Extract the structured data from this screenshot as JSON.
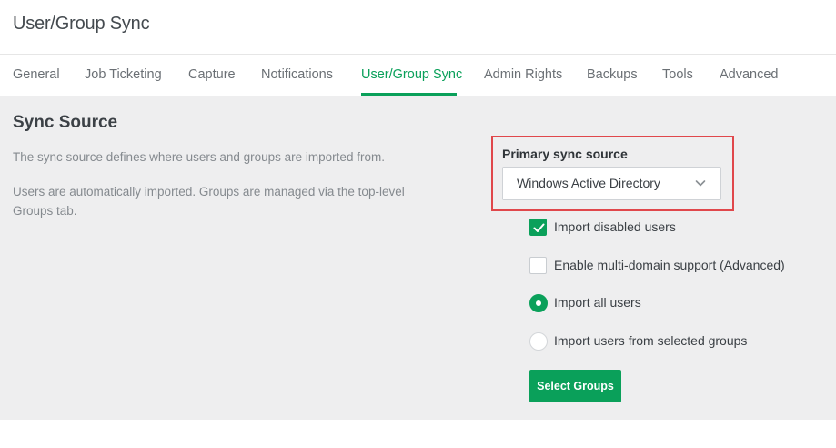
{
  "page": {
    "title": "User/Group Sync"
  },
  "tabs": [
    {
      "label": "General",
      "active": false
    },
    {
      "label": "Job Ticketing",
      "active": false
    },
    {
      "label": "Capture",
      "active": false
    },
    {
      "label": "Notifications",
      "active": false
    },
    {
      "label": "User/Group Sync",
      "active": true
    },
    {
      "label": "Admin Rights",
      "active": false
    },
    {
      "label": "Backups",
      "active": false
    },
    {
      "label": "Tools",
      "active": false
    },
    {
      "label": "Advanced",
      "active": false
    }
  ],
  "sync_source": {
    "title": "Sync Source",
    "description_1": "The sync source defines where users and groups are imported from.",
    "description_2": "Users are automatically imported. Groups are managed via the top-level Groups tab.",
    "primary_label": "Primary sync source",
    "primary_value": "Windows Active Directory",
    "options": {
      "import_disabled": {
        "label": "Import disabled users",
        "checked": true
      },
      "multi_domain": {
        "label": "Enable multi-domain support (Advanced)",
        "checked": false
      },
      "import_all": {
        "label": "Import all users",
        "selected": true
      },
      "import_selected": {
        "label": "Import users from selected groups",
        "selected": false
      }
    },
    "select_groups_label": "Select Groups"
  },
  "colors": {
    "accent": "#0aa05a",
    "highlight": "#e0474b",
    "panel_bg": "#eeeeef"
  },
  "icons": {
    "dropdown": "chevron-down-icon",
    "check": "checkmark-icon"
  }
}
